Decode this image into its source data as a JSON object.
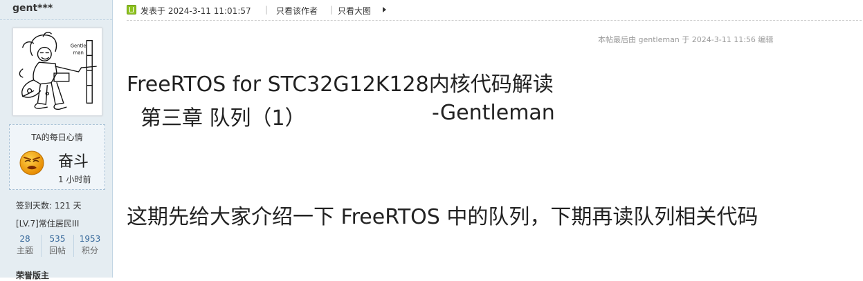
{
  "user": {
    "name": "gent***",
    "avatar_text": [
      "Gentle",
      "man"
    ],
    "mood": {
      "title": "TA的每日心情",
      "status": "奋斗",
      "time": "1 小时前"
    },
    "signin": "签到天数: 121 天",
    "level": "[LV.7]常住居民III",
    "stats": [
      {
        "value": "28",
        "label": "主题"
      },
      {
        "value": "535",
        "label": "回帖"
      },
      {
        "value": "1953",
        "label": "积分"
      }
    ],
    "honor": "荣誉版主"
  },
  "post": {
    "posted": "发表于 2024-3-11 11:01:57",
    "sep": "|",
    "only_author": "只看该作者",
    "big_image": "只看大图",
    "edit_note": "本帖最后由 gentleman 于 2024-3-11 11:56 编辑",
    "title": "FreeRTOS for STC32G12K128内核代码解读",
    "subtitle": "第三章  队列（1）",
    "author_tag": "-Gentleman",
    "intro": "这期先给大家介绍一下 FreeRTOS 中的队列，下期再读队列相关代码"
  },
  "colors": {
    "sidebar_bg": "#e5edf2",
    "sidebar_border": "#c2d5e3",
    "link": "#336699",
    "online_icon": "#8fc320"
  },
  "icons": [
    "online-status-icon",
    "arrow-right-icon",
    "mood-face-icon"
  ]
}
